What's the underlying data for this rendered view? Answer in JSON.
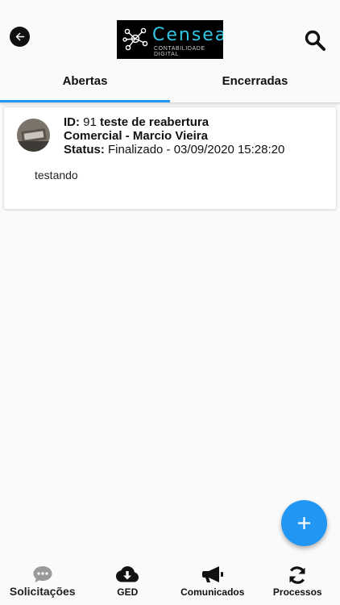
{
  "header": {
    "back_icon": "arrow-left-circle-icon",
    "logo": {
      "name": "Censea",
      "subtitle": "CONTABILIDADE DIGITAL",
      "accent": "#2fc9e6"
    },
    "search_icon": "search-icon"
  },
  "tabs": [
    {
      "label": "Abertas",
      "active": true
    },
    {
      "label": "Encerradas",
      "active": false
    }
  ],
  "tickets": [
    {
      "id_label": "ID:",
      "id_value": "91",
      "title": "teste de reabertura",
      "department": "Comercial - Marcio Vieira",
      "status_label": "Status:",
      "status_value": "Finalizado - 03/09/2020 15:28:20",
      "description": "testando"
    }
  ],
  "fab": {
    "icon": "plus-icon"
  },
  "bottom_nav": [
    {
      "label": "Solicitações",
      "icon": "chat-bubble-icon",
      "active": true
    },
    {
      "label": "GED",
      "icon": "cloud-download-icon",
      "active": false
    },
    {
      "label": "Comunicados",
      "icon": "megaphone-icon",
      "active": false
    },
    {
      "label": "Processos",
      "icon": "sync-icon",
      "active": false
    }
  ],
  "colors": {
    "accent": "#2196f3",
    "background": "#fafafa",
    "text": "#111111"
  }
}
